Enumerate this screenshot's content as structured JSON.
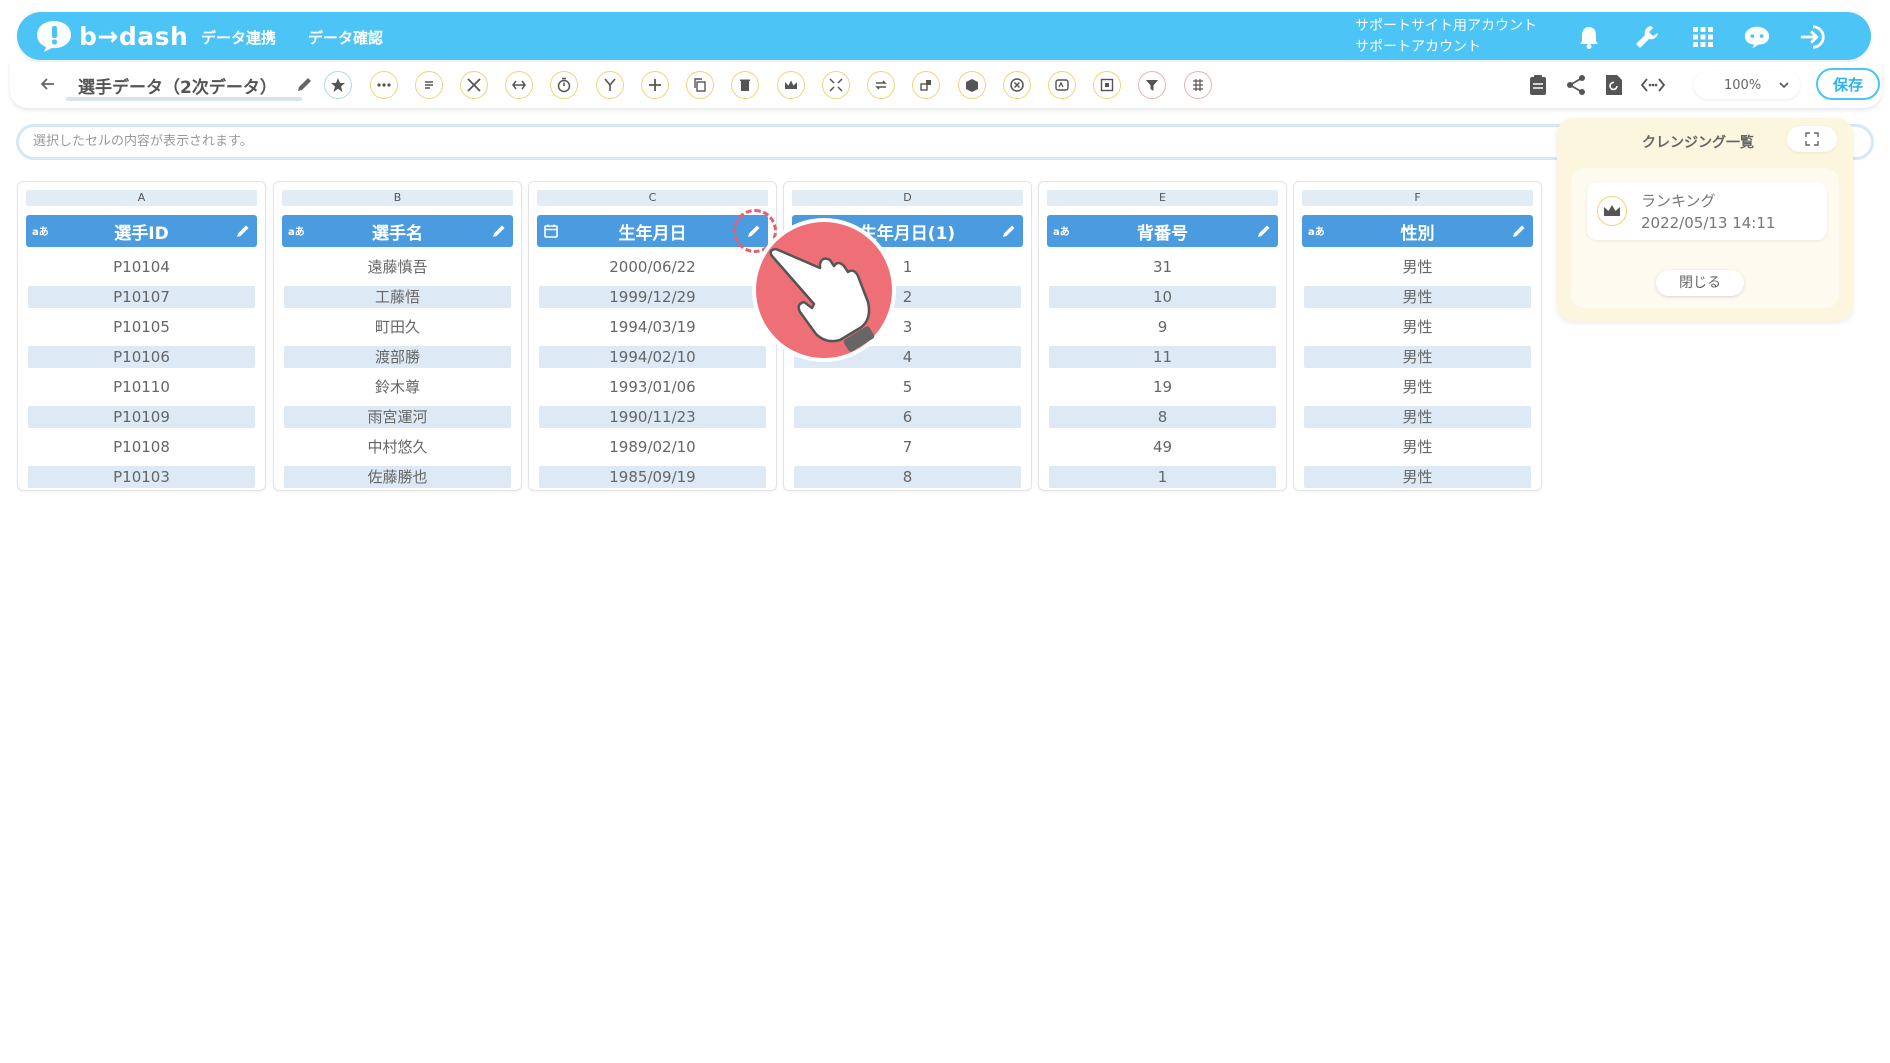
{
  "header": {
    "logo_text": "b→dash",
    "nav": [
      "データ連携",
      "データ確認"
    ],
    "account_line1": "サポートサイト用アカウント",
    "account_line2": "サポートアカウント"
  },
  "toolbar": {
    "title": "選手データ（2次データ）",
    "zoom": "100%",
    "save_label": "保存"
  },
  "cell_bar": {
    "placeholder": "選択したセルの内容が表示されます。"
  },
  "columns": [
    {
      "letter": "A",
      "name": "選手ID",
      "type": "text",
      "type_label": "aあ",
      "values": [
        "P10104",
        "P10107",
        "P10105",
        "P10106",
        "P10110",
        "P10109",
        "P10108",
        "P10103"
      ]
    },
    {
      "letter": "B",
      "name": "選手名",
      "type": "text",
      "type_label": "aあ",
      "values": [
        "遠藤慎吾",
        "工藤悟",
        "町田久",
        "渡部勝",
        "鈴木尊",
        "雨宮運河",
        "中村悠久",
        "佐藤勝也"
      ]
    },
    {
      "letter": "C",
      "name": "生年月日",
      "type": "date",
      "type_label": "",
      "values": [
        "2000/06/22",
        "1999/12/29",
        "1994/03/19",
        "1994/02/10",
        "1993/01/06",
        "1990/11/23",
        "1989/02/10",
        "1985/09/19"
      ]
    },
    {
      "letter": "D",
      "name": "生年月日(1)",
      "type": "text",
      "type_label": "",
      "values": [
        "1",
        "2",
        "3",
        "4",
        "5",
        "6",
        "7",
        "8"
      ]
    },
    {
      "letter": "E",
      "name": "背番号",
      "type": "text",
      "type_label": "aあ",
      "values": [
        "31",
        "10",
        "9",
        "11",
        "19",
        "8",
        "49",
        "1"
      ]
    },
    {
      "letter": "F",
      "name": "性別",
      "type": "text",
      "type_label": "aあ",
      "values": [
        "男性",
        "男性",
        "男性",
        "男性",
        "男性",
        "男性",
        "男性",
        "男性"
      ]
    }
  ],
  "cleansing_panel": {
    "title": "クレンジング一覧",
    "items": [
      {
        "name": "ランキング",
        "date": "2022/05/13 14:11"
      }
    ],
    "close_label": "閉じる"
  },
  "colors": {
    "header_bg": "#4cc4f6",
    "column_header": "#4a9be0",
    "panel_bg": "#fdf6df",
    "pointer": "#ef6f76"
  }
}
